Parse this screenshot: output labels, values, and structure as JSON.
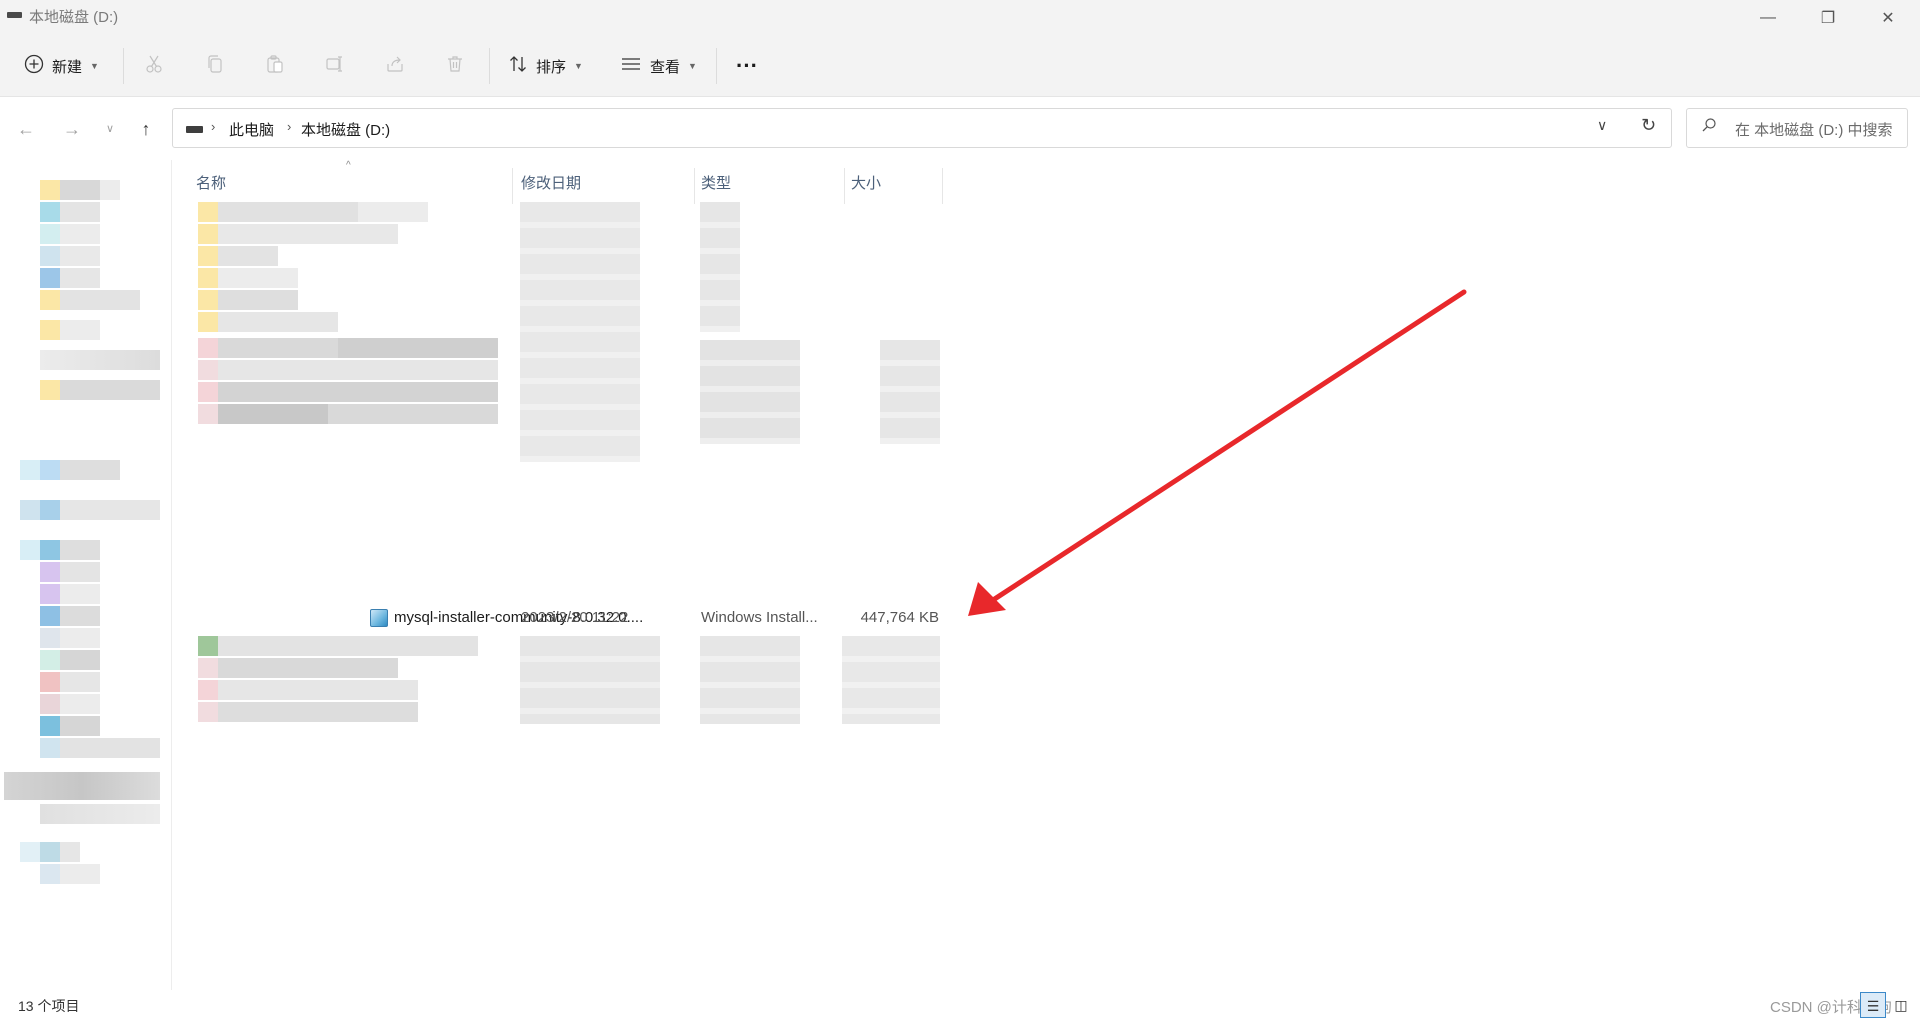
{
  "window": {
    "title": "本地磁盘 (D:)",
    "minimize_glyph": "—",
    "maximize_glyph": "❐",
    "close_glyph": "✕"
  },
  "toolbar": {
    "new_label": "新建",
    "sort_label": "排序",
    "view_label": "查看",
    "more_glyph": "···",
    "icons": [
      "plus-circle-icon",
      "cut-icon",
      "copy-icon",
      "paste-icon",
      "rename-icon",
      "share-icon",
      "delete-icon",
      "sort-icon",
      "view-icon",
      "more-icon"
    ]
  },
  "address": {
    "crumbs": [
      "此电脑",
      "本地磁盘 (D:)"
    ],
    "search_placeholder": "在 本地磁盘 (D:) 中搜索"
  },
  "columns": {
    "name": "名称",
    "date": "修改日期",
    "type": "类型",
    "size": "大小"
  },
  "highlighted_file": {
    "name": "mysql-installer-community-8.0.32.0....",
    "date": "2023/2/20 11:22",
    "type": "Windows Install...",
    "size": "447,764 KB"
  },
  "status": {
    "item_count": "13 个项目",
    "watermark": "CSDN @计科土狗"
  },
  "colors": {
    "arrow": "#e8282b",
    "header_text": "#4c607a",
    "accent": "#3c89c9"
  }
}
